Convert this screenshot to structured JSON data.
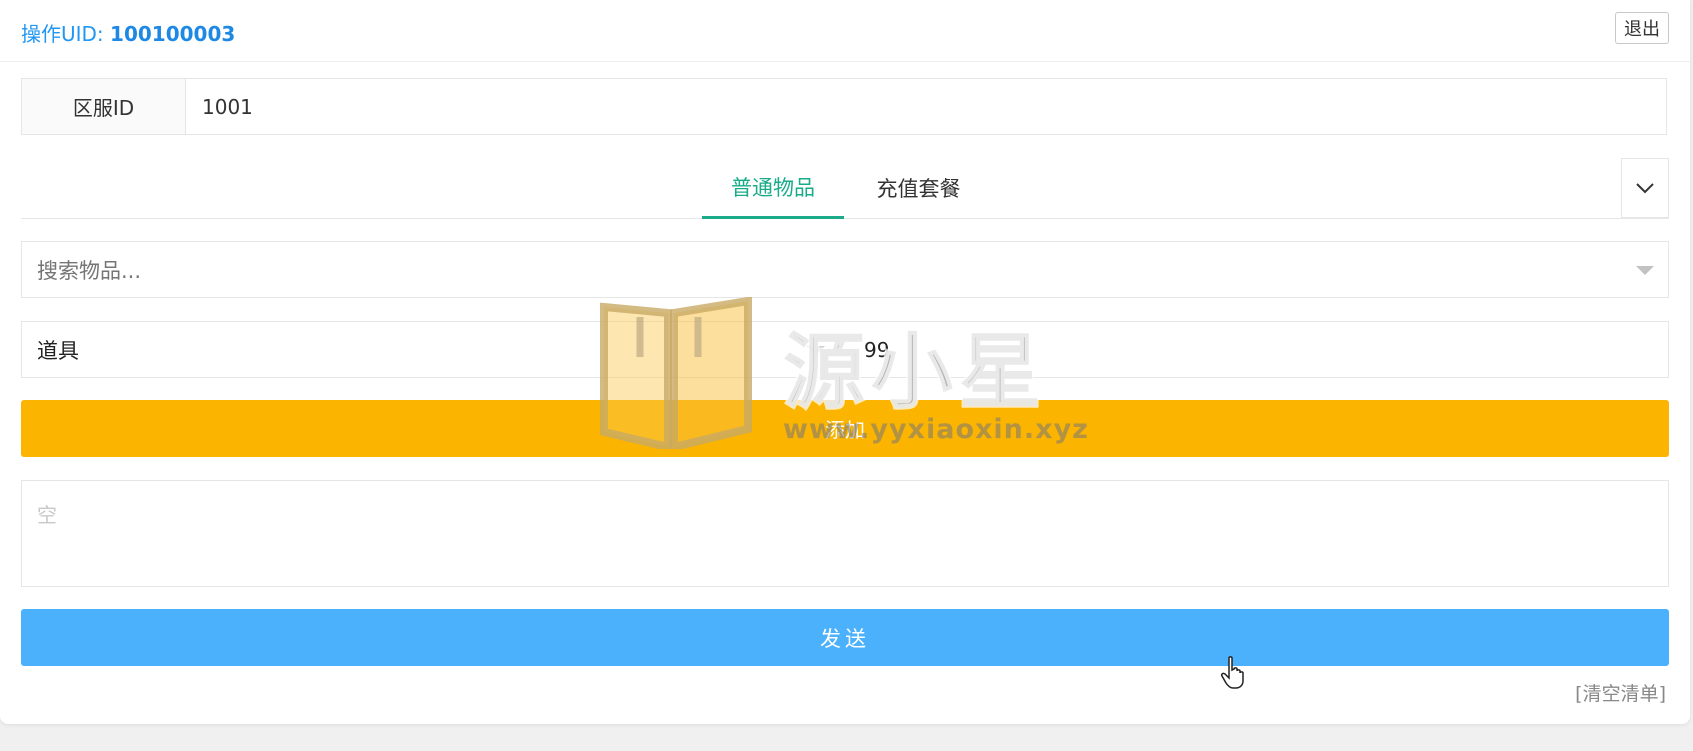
{
  "header": {
    "uid_label": "操作UID:",
    "uid_value": "100100003",
    "logout_label": "退出"
  },
  "server": {
    "label": "区服ID",
    "value": "1001"
  },
  "tabs": [
    {
      "label": "普通物品",
      "active": true
    },
    {
      "label": "充值套餐",
      "active": false
    }
  ],
  "tab_expand_icon": "chevron-down-icon",
  "search": {
    "placeholder": "搜索物品..."
  },
  "item": {
    "type": "道具",
    "quantity": "99"
  },
  "add_button": {
    "label": "添加",
    "color": "#fbb400"
  },
  "list": {
    "empty_text": "空"
  },
  "send_button": {
    "label": "发送",
    "color": "#4bb1fc"
  },
  "clear_link": "[清空清单]",
  "watermark": {
    "title": "源小星",
    "url": "www.yyxiaoxin.xyz"
  },
  "colors": {
    "accent_green": "#1aab8a",
    "uid_blue": "#2196f3"
  }
}
